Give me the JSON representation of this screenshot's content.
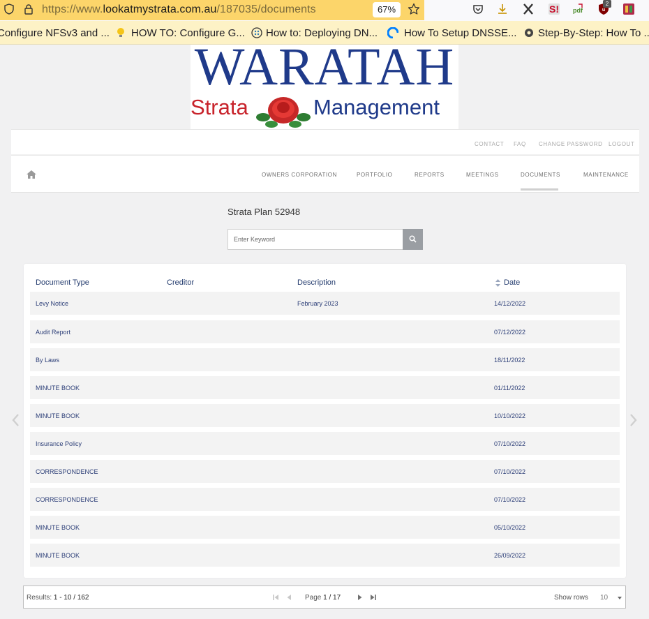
{
  "browser": {
    "url_prefix": "https://www.",
    "url_domain": "lookatmystrata.com.au",
    "url_path": "/187035/documents",
    "zoom": "67%",
    "ext_badge": "2"
  },
  "bookmarks": [
    {
      "label": "Configure NFSv3 and ..."
    },
    {
      "label": "HOW TO: Configure G..."
    },
    {
      "label": "How to: Deploying DN..."
    },
    {
      "label": "How To Setup DNSSE..."
    },
    {
      "label": "Step-By-Step: How To ..."
    }
  ],
  "logo": {
    "title": "WARATAH",
    "sub_left": "Strata",
    "sub_right": "Management"
  },
  "topnav": [
    "CONTACT",
    "FAQ",
    "CHANGE PASSWORD",
    "LOGOUT"
  ],
  "mainnav": [
    "OWNERS CORPORATION",
    "PORTFOLIO",
    "REPORTS",
    "MEETINGS",
    "DOCUMENTS",
    "MAINTENANCE"
  ],
  "plan_title": "Strata Plan 52948",
  "search": {
    "placeholder": "Enter Keyword"
  },
  "table": {
    "headers": [
      "Document Type",
      "Creditor",
      "Description",
      "Date"
    ],
    "rows": [
      {
        "type": "Levy Notice",
        "creditor": "",
        "description": "February 2023",
        "date": "14/12/2022"
      },
      {
        "type": "Audit Report",
        "creditor": "",
        "description": "",
        "date": "07/12/2022"
      },
      {
        "type": "By Laws",
        "creditor": "",
        "description": "",
        "date": "18/11/2022"
      },
      {
        "type": "MINUTE BOOK",
        "creditor": "",
        "description": "",
        "date": "01/11/2022"
      },
      {
        "type": "MINUTE BOOK",
        "creditor": "",
        "description": "",
        "date": "10/10/2022"
      },
      {
        "type": "Insurance Policy",
        "creditor": "",
        "description": "",
        "date": "07/10/2022"
      },
      {
        "type": "CORRESPONDENCE",
        "creditor": "",
        "description": "",
        "date": "07/10/2022"
      },
      {
        "type": "CORRESPONDENCE",
        "creditor": "",
        "description": "",
        "date": "07/10/2022"
      },
      {
        "type": "MINUTE BOOK",
        "creditor": "",
        "description": "",
        "date": "05/10/2022"
      },
      {
        "type": "MINUTE BOOK",
        "creditor": "",
        "description": "",
        "date": "26/09/2022"
      }
    ]
  },
  "pager": {
    "results_label": "Results: ",
    "results_value": "1 - 10 / 162",
    "page_label": "Page ",
    "page_value": "1 / 17",
    "show_rows_label": "Show rows",
    "rows_value": "10"
  },
  "colors": {
    "url_bar": "#fcd56a",
    "bookmarks_bar": "#fdf2c6",
    "brand_blue": "#1f3a8a",
    "brand_red": "#c8232b",
    "link_text": "#2d3f78"
  }
}
